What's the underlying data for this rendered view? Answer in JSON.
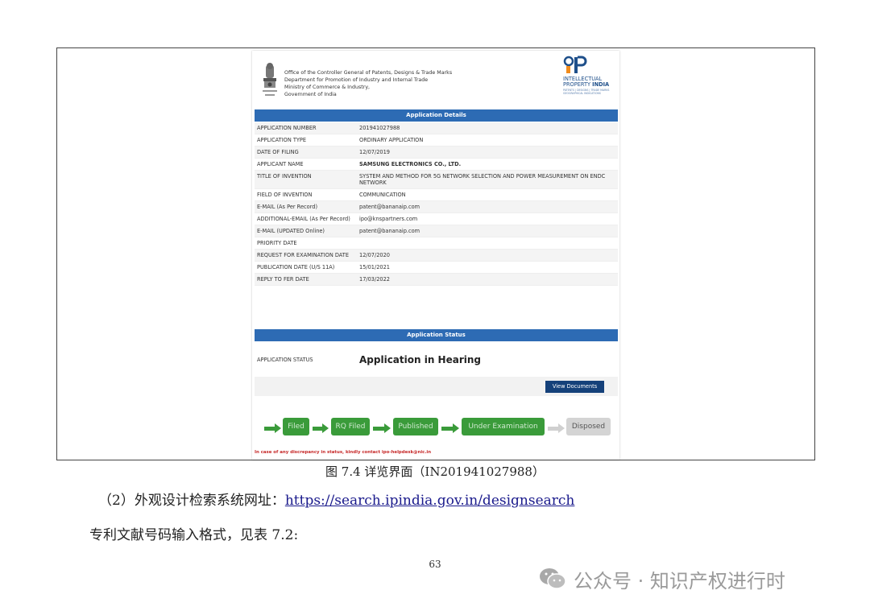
{
  "office": {
    "lines": [
      "Office of the Controller General of Patents, Designs & Trade Marks",
      "Department for Promotion of Industry and Internal Trade",
      "Ministry of Commerce & Industry,",
      "Government of India"
    ]
  },
  "ip_logo": {
    "line1": "INTELLECTUAL",
    "line2": "PROPERTY",
    "line2b": "INDIA",
    "tagline1": "PATENTS | DESIGNS | TRADE MARKS",
    "tagline2": "GEOGRAPHICAL INDICATIONS"
  },
  "application_details": {
    "heading": "Application Details",
    "rows": [
      {
        "key": "APPLICATION NUMBER",
        "value": "201941027988"
      },
      {
        "key": "APPLICATION TYPE",
        "value": "ORDINARY APPLICATION"
      },
      {
        "key": "DATE OF FILING",
        "value": "12/07/2019"
      },
      {
        "key": "APPLICANT NAME",
        "value": "SAMSUNG ELECTRONICS CO., LTD."
      },
      {
        "key": "TITLE OF INVENTION",
        "value": "SYSTEM AND METHOD FOR 5G NETWORK SELECTION AND POWER MEASUREMENT ON ENDC NETWORK"
      },
      {
        "key": "FIELD OF INVENTION",
        "value": "COMMUNICATION"
      },
      {
        "key": "E-MAIL (As Per Record)",
        "value": "patent@bananaip.com"
      },
      {
        "key": "ADDITIONAL-EMAIL (As Per Record)",
        "value": "ipo@knspartners.com"
      },
      {
        "key": "E-MAIL (UPDATED Online)",
        "value": "patent@bananaip.com"
      },
      {
        "key": "PRIORITY DATE",
        "value": ""
      },
      {
        "key": "REQUEST FOR EXAMINATION DATE",
        "value": "12/07/2020"
      },
      {
        "key": "PUBLICATION DATE (U/S 11A)",
        "value": "15/01/2021"
      },
      {
        "key": "REPLY TO FER DATE",
        "value": "17/03/2022"
      }
    ]
  },
  "application_status": {
    "heading": "Application Status",
    "key": "APPLICATION STATUS",
    "value": "Application in Hearing",
    "view_documents": "View Documents"
  },
  "progress": {
    "steps": [
      {
        "label": "Filed",
        "done": true
      },
      {
        "label": "RQ Filed",
        "done": true
      },
      {
        "label": "Published",
        "done": true
      },
      {
        "label": "Under Examination",
        "done": true
      },
      {
        "label": "Disposed",
        "done": false
      }
    ]
  },
  "note": "In case of any discrepancy in status, kindly contact ipo-helpdesk@nic.in",
  "document": {
    "caption": "图 7.4  详览界面（IN201941027988）",
    "para1_prefix": "（2）外观设计检索系统网址：",
    "para1_link": "https://search.ipindia.gov.in/designsearch",
    "para2": "专利文献号码输入格式，见表 7.2:",
    "page_number": "63"
  },
  "watermark": {
    "text": "公众号 · 知识产权进行时"
  },
  "colors": {
    "bar_blue": "#2d6bb4",
    "button_navy": "#15417a",
    "step_green": "#3a9b3a",
    "step_grey": "#d4d4d4",
    "note_red": "#c62828"
  }
}
